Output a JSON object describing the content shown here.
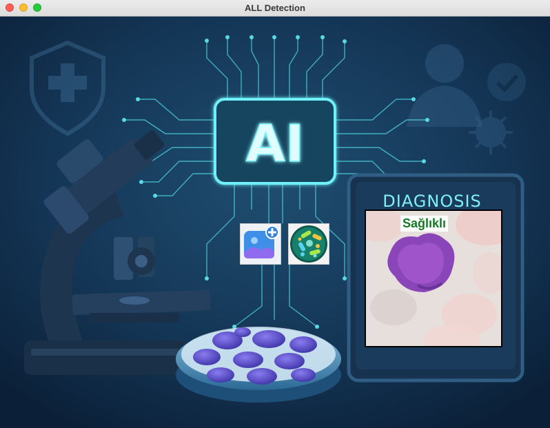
{
  "window": {
    "title": "ALL Detection"
  },
  "scene": {
    "ai_badge_text": "AI",
    "panel_title": "DIAGNOSIS"
  },
  "toolbar": {
    "upload_icon": "add-image-icon",
    "analyze_icon": "bacteria-cells-icon"
  },
  "result": {
    "label": "Sağlıklı",
    "label_color": "#137a23"
  },
  "colors": {
    "background": "#0d2a45",
    "neon": "#5fe8f0",
    "panel": "#16324f"
  }
}
